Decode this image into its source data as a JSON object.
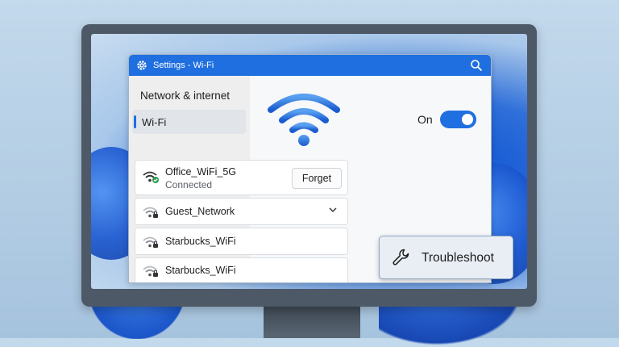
{
  "window": {
    "title": "Settings - Wi-Fi"
  },
  "sidebar": {
    "heading": "Network & internet",
    "items": [
      {
        "label": "Wi-Fi",
        "selected": true
      }
    ]
  },
  "wifi": {
    "toggle_label": "On",
    "enabled": true
  },
  "networks": [
    {
      "name": "Office_WiFi_5G",
      "status": "Connected",
      "action": "Forget",
      "secured": true,
      "connected": true
    },
    {
      "name": "Guest_Network",
      "secured": true,
      "expandable": true
    },
    {
      "name": "Starbucks_WiFi",
      "secured": true
    },
    {
      "name": "Starbucks_WiFi",
      "secured": true
    }
  ],
  "troubleshoot": {
    "label": "Troubleshoot",
    "icon": "wrench-icon"
  },
  "colors": {
    "accent": "#1f6fe0",
    "connected": "#2e9e4f"
  }
}
